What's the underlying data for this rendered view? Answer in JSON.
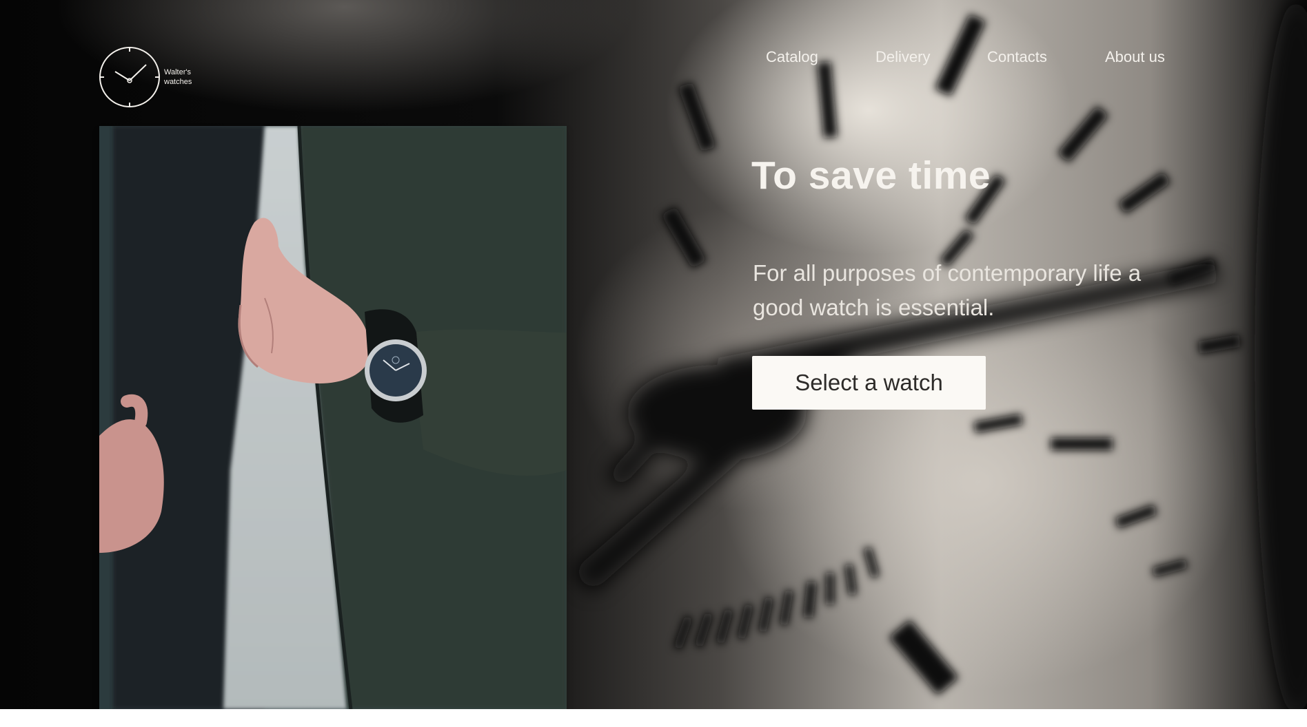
{
  "brand": {
    "name": "Walter's\nwatches",
    "logo_icon": "clock-icon"
  },
  "nav": {
    "items": [
      {
        "label": "Catalog"
      },
      {
        "label": "Delivery"
      },
      {
        "label": "Contacts"
      },
      {
        "label": "About us"
      }
    ]
  },
  "hero": {
    "title": "To save time",
    "subtitle": "For all purposes of contemporary life a good watch is essential.",
    "cta_label": "Select a watch",
    "photo_alt": "wristwatch-photo"
  },
  "colors": {
    "text_light": "#f6f3ee",
    "button_bg": "#fbf9f5",
    "button_text": "#2d2b29",
    "page_bg": "#ffffff"
  }
}
